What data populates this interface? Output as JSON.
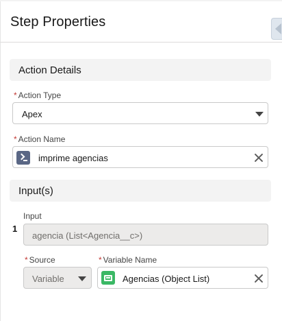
{
  "header": {
    "title": "Step Properties"
  },
  "sections": {
    "action_details": "Action Details",
    "inputs": "Input(s)"
  },
  "action_type": {
    "label": "Action Type",
    "required_marker": "*",
    "value": "Apex"
  },
  "action_name": {
    "label": "Action Name",
    "required_marker": "*",
    "value": "imprime agencias",
    "icon": "apex-terminal-icon"
  },
  "input_row": {
    "index": "1",
    "input_label": "Input",
    "input_value": "agencia (List<Agencia__c>)",
    "source_label": "Source",
    "source_required_marker": "*",
    "source_value": "Variable",
    "variable_name_label": "Variable Name",
    "variable_name_required_marker": "*",
    "variable_name_value": "Agencias (Object List)",
    "variable_icon": "object-list-icon"
  },
  "colors": {
    "required": "#c23934",
    "section_bg": "#f3f3f3",
    "apex_icon_bg": "#5a6785",
    "variable_icon_bg": "#3bb865"
  }
}
